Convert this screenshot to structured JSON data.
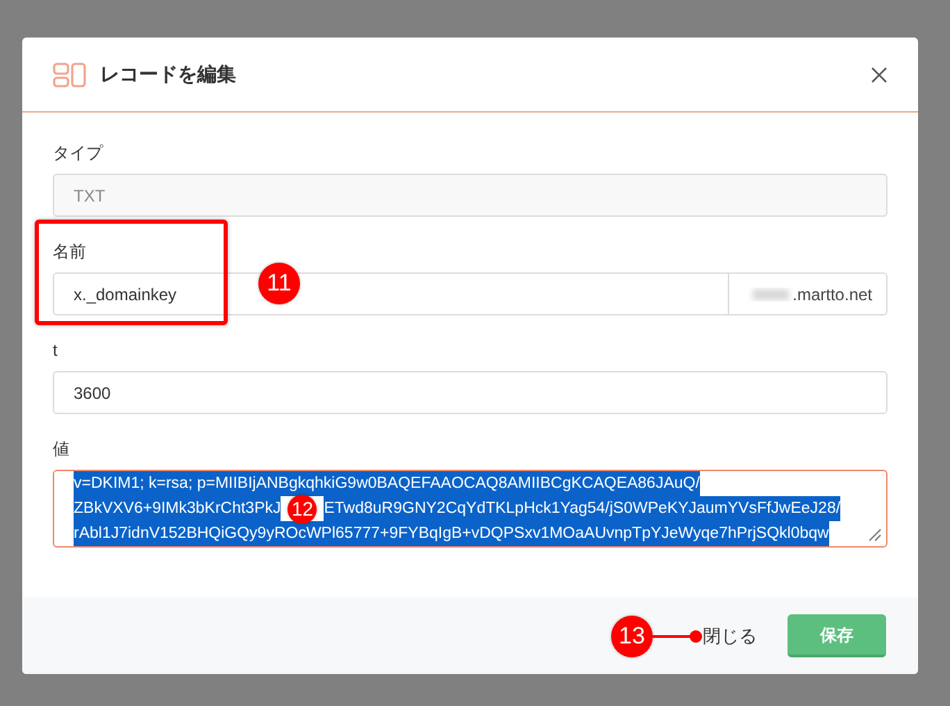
{
  "dialog": {
    "title": "レコードを編集",
    "fields": [
      {
        "kind": "text",
        "label": "タイプ",
        "value": "TXT",
        "disabled": true
      },
      {
        "kind": "suffix",
        "label": "名前",
        "value": "x._domainkey",
        "suffix": ".martto.net",
        "disabled": false,
        "highlighted": true,
        "annotation": "11"
      },
      {
        "kind": "text",
        "label": "t",
        "value": "3600",
        "disabled": false
      },
      {
        "kind": "textarea",
        "label": "値",
        "selected": true,
        "annotation": "12",
        "lines": [
          [
            "v=DKIM1; k=rsa; p=MIIBIjANBgkqhkiG9w0BAQEFAAOCAQ8AMIIBCgKCAQEA86JAuQ/"
          ],
          [
            "ZBkVXV6+9IMk3bKrCht3PkJ",
            "ETwd8uR9GNY2CqYdTKLpHck1Yag54/jS0WPeKYJaumYVsFfJwEeJ28/"
          ],
          [
            "rAbl1J7idnV152BHQiGQy9yROcWPl65777+9FYBqIgB+vDQPSxv1MOaAUvnpTpYJeWyqe7hPrjSQkl0bqw"
          ]
        ]
      }
    ],
    "close_label": "閉じる",
    "close_annotation": "13",
    "save_label": "保存"
  }
}
